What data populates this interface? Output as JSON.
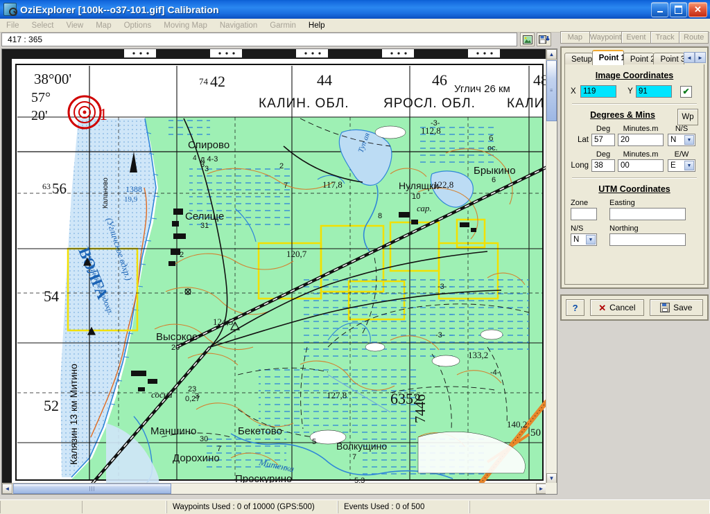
{
  "window": {
    "title": "OziExplorer [100k--o37-101.gif] Calibration",
    "icon": "oziexplorer-icon",
    "minimize_label": "_",
    "maximize_label": "❐",
    "close_label": "✕"
  },
  "menu": {
    "items": [
      {
        "label": "File",
        "enabled": false
      },
      {
        "label": "Select",
        "enabled": false
      },
      {
        "label": "View",
        "enabled": false
      },
      {
        "label": "Map",
        "enabled": false
      },
      {
        "label": "Options",
        "enabled": false
      },
      {
        "label": "Moving Map",
        "enabled": false
      },
      {
        "label": "Navigation",
        "enabled": false
      },
      {
        "label": "Garmin",
        "enabled": false
      },
      {
        "label": "Help",
        "enabled": true
      }
    ]
  },
  "toolbar": {
    "coordinate_readout": "417 : 365",
    "buttons": [
      {
        "name": "image-icon",
        "glyph": "⛰"
      },
      {
        "name": "save-map-icon",
        "glyph": "⬇"
      }
    ]
  },
  "top_tabs": [
    {
      "label": "Map"
    },
    {
      "label": "Waypoint"
    },
    {
      "label": "Event"
    },
    {
      "label": "Track"
    },
    {
      "label": "Route"
    }
  ],
  "panel": {
    "tabs": [
      {
        "label": "Setup",
        "active": false
      },
      {
        "label": "Point 1",
        "active": true
      },
      {
        "label": "Point 2",
        "active": false
      },
      {
        "label": "Point 3",
        "active": false,
        "clipped": true
      }
    ],
    "tab_nav": {
      "prev": "◄",
      "next": "►"
    },
    "image_coordinates": {
      "title": "Image Coordinates",
      "x_label": "X",
      "x_value": "119",
      "y_label": "Y",
      "y_value": "91",
      "checkbox_checked": true,
      "checkbox_glyph": "✔",
      "field_color": "#00e5ff"
    },
    "degrees_mins": {
      "title": "Degrees & Mins",
      "wp_button": "Wp",
      "deg_header": "Deg",
      "minutes_header": "Minutes.m",
      "ns_header": "N/S",
      "ew_header": "E/W",
      "lat_label": "Lat",
      "lat_deg": "57",
      "lat_min": "20",
      "lat_ns": "N",
      "long_label": "Long",
      "long_deg": "38",
      "long_min": "00",
      "long_ew": "E"
    },
    "utm": {
      "title": "UTM Coordinates",
      "zone_label": "Zone",
      "zone_value": "",
      "easting_label": "Easting",
      "easting_value": "",
      "ns_label": "N/S",
      "ns_value": "N",
      "northing_label": "Northing",
      "northing_value": ""
    },
    "buttons": {
      "help_label": "?",
      "cancel_label": "Cancel",
      "save_label": "Save"
    }
  },
  "status": {
    "waypoints": "Waypoints Used : 0 of 10000  (GPS:500)",
    "events": "Events Used : 0 of 500"
  },
  "map": {
    "labels": {
      "lon_corner": "38°00'",
      "lat_corner_a": "57°",
      "lat_corner_b": "20'",
      "point_marker": "1",
      "grid_74": "74",
      "grid_42": "42",
      "grid_44": "44",
      "grid_46": "46",
      "grid_48": "48",
      "grid_63": "63",
      "grid_56": "56",
      "grid_54": "54",
      "grid_52": "52",
      "grid_50": "50",
      "region_left": "КАЛИН. ОБЛ.",
      "region_mid": "ЯРОСЛ. ОБЛ.",
      "region_right": "КАЛИ",
      "uglich": "Углич 26 км",
      "spirovo": "Спирово",
      "nulyashki": "Нуляшки",
      "brykino": "Брыкино",
      "selishche": "Селище",
      "vysokoe": "Высокое",
      "manshino": "Маншино",
      "beketovo": "Бекетово",
      "dorokhino": "Дорохино",
      "proskurino": "Проскурино",
      "volkushino": "Волкущино",
      "volga": "ВОЛГА",
      "volga_sub": "Угличское водохр.",
      "kalyazin": "Калязин 13 км Митино",
      "kalanovo": "Каланово",
      "mitenka": "Митенка",
      "sosna": "сосна",
      "sar": "сар.",
      "elev_1388": "1388",
      "elev_199": "19,9",
      "elev_1178": "117,8",
      "elev_1228a": "112,8",
      "elev_1228b": "122,8",
      "elev_1207": "120,7",
      "elev_1245": "124,5",
      "elev_1332": "133,2",
      "elev_1278": "127,8",
      "elev_1402": "140,2",
      "grid_6352": "6352",
      "grid_7446": "7446",
      "num_31": "31",
      "num_20": "20",
      "num_30": "30",
      "num_10": "10",
      "num_5": "5",
      "num_6": "6",
      "num_7": "7",
      "num_53": "5,3",
      "num_23": "23",
      "num_027": "0,27",
      "num_d43": "д 4-3",
      "num_3": "3",
      "num_4": "4",
      "num_2": "2",
      "num_8": "8"
    },
    "colors": {
      "forest": "#9ef0b4",
      "water": "#7fb8e8",
      "water_fill": "#c9e2f6",
      "paper": "#ffffff",
      "road_orange": "#e8862a",
      "contour": "#cf7a30",
      "marker_red": "#d00000",
      "yellow_field": "#f5e800"
    }
  }
}
